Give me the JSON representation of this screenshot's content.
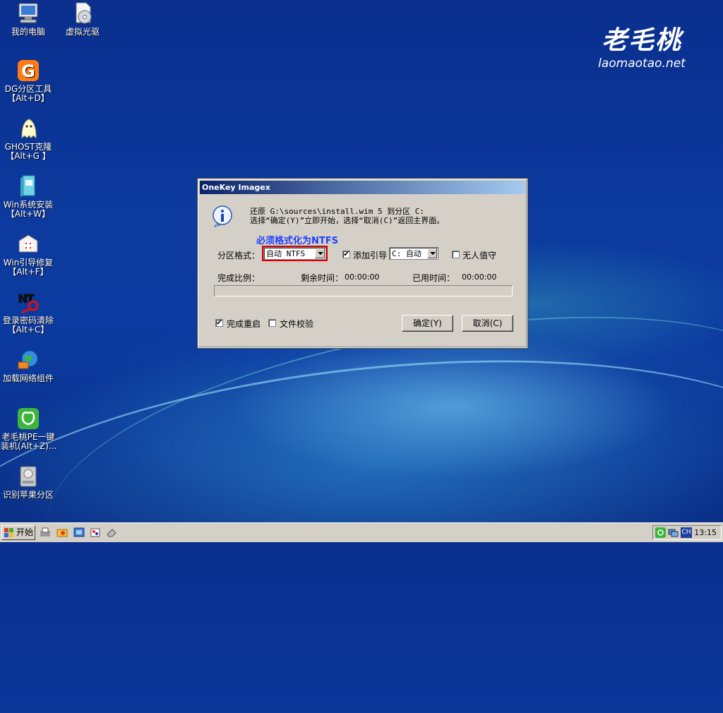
{
  "desktop": {
    "icons": [
      {
        "name": "my-computer",
        "label": "我的电脑",
        "icon": "computer-icon"
      },
      {
        "name": "virtual-drive",
        "label": "虚拟光驱",
        "icon": "virtual-cd-icon"
      },
      {
        "name": "dg-partition",
        "label": "DG分区工具\n【Alt+D】",
        "icon": "diskgenius-icon"
      },
      {
        "name": "ghost",
        "label": "GHOST克隆\n【Alt+G 】",
        "icon": "ghost-icon"
      },
      {
        "name": "win-install",
        "label": "Win系统安装\n【Alt+W】",
        "icon": "win-install-icon"
      },
      {
        "name": "boot-repair",
        "label": "Win引导修复\n【Alt+F】",
        "icon": "boot-repair-icon"
      },
      {
        "name": "password-clear",
        "label": "登录密码清除\n【Alt+C】",
        "icon": "key-icon"
      },
      {
        "name": "network",
        "label": "加载网络组件",
        "icon": "network-globe-icon"
      },
      {
        "name": "laomaotao-pe",
        "label": "老毛桃PE一键\n装机(Alt+Z)...",
        "icon": "laomaotao-icon"
      },
      {
        "name": "apple-partition",
        "label": "识别苹果分区",
        "icon": "hard-disk-icon"
      }
    ]
  },
  "logo": {
    "cn": "老毛桃",
    "en": "laomaotao.net"
  },
  "dialog": {
    "title": "OneKey Imagex",
    "message_line1": "还原 G:\\sources\\install.wim 5 到分区 C:",
    "message_line2": "选择“确定(Y)”立即开始，选择“取消(C)”返回主界面。",
    "warning": "必须格式化为NTFS",
    "format_label": "分区格式：",
    "format_value": "自动 NTFS",
    "boot_label": "添加引导",
    "boot_checked": true,
    "boot_value": "C: 自动",
    "unattended_label": "无人值守",
    "unattended_checked": false,
    "progress_label": "完成比例：",
    "remaining_label": "剩余时间：",
    "remaining_value": "00:00:00",
    "elapsed_label": "已用时间：",
    "elapsed_value": "00:00:00",
    "progress_fraction": 0,
    "reboot_label": "完成重启",
    "reboot_checked": true,
    "verify_label": "文件校验",
    "verify_checked": false,
    "ok_label": "确定(Y)",
    "cancel_label": "取消(C)"
  },
  "taskbar": {
    "start_label": "开始",
    "quicklaunch": [
      "install-icon",
      "explorer-icon",
      "media-icon",
      "paint-icon",
      "eraser-icon"
    ],
    "tray": {
      "lang": "CH",
      "clock": "13:15"
    }
  }
}
